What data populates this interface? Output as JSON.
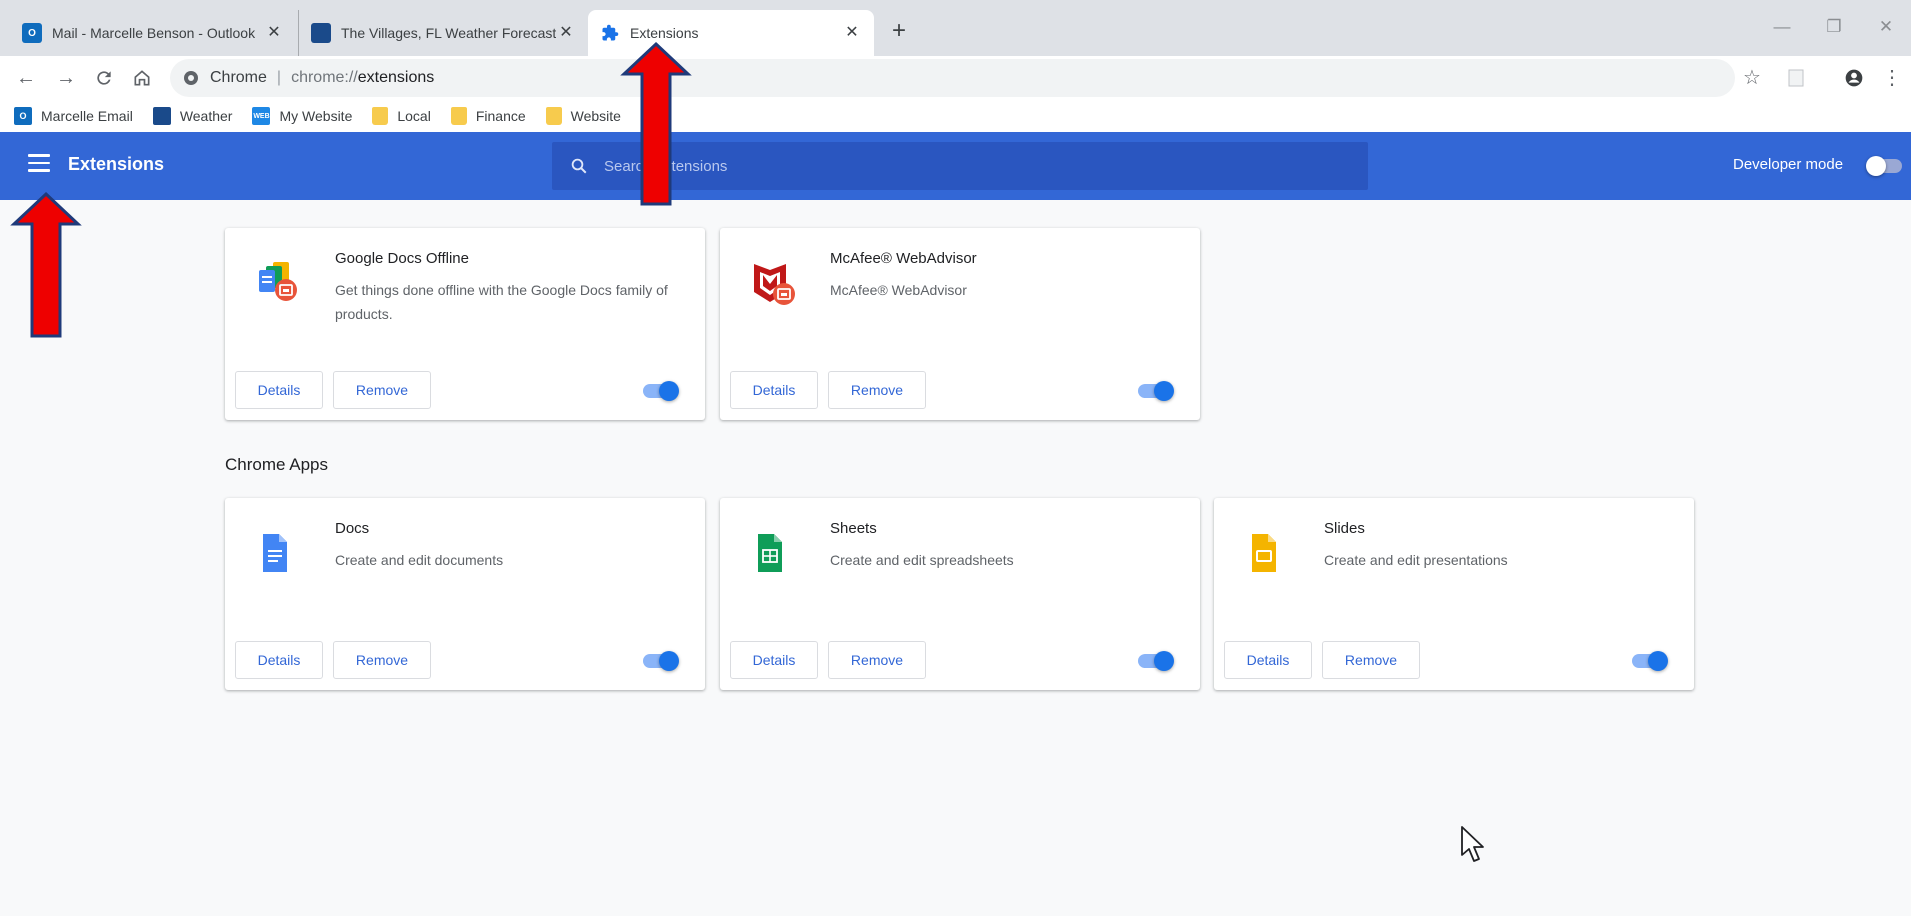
{
  "tabs": [
    {
      "title": "Mail - Marcelle Benson - Outlook",
      "icon": "outlook-icon",
      "color": "#0f6cbd"
    },
    {
      "title": "The Villages, FL Weather Forecast",
      "icon": "weather-icon",
      "color": "#1a4a8a"
    },
    {
      "title": "Extensions",
      "icon": "puzzle-icon",
      "color": "#1a73e8"
    }
  ],
  "tab_close_glyph": "✕",
  "new_tab_glyph": "+",
  "window_controls": {
    "minimize": "—",
    "restore": "❐",
    "close": "✕"
  },
  "omnibox": {
    "site": "Chrome",
    "separator": "|",
    "url_scheme": "chrome://",
    "url_path": "extensions"
  },
  "bookmarks": [
    {
      "label": "Marcelle Email",
      "icon": "outlook-icon",
      "color": "#0f6cbd",
      "badge": "O"
    },
    {
      "label": "Weather",
      "icon": "weather-icon",
      "color": "#1a4a8a",
      "badge": ""
    },
    {
      "label": "My Website",
      "icon": "website-icon",
      "color": "#1e88e5",
      "badge": "WEB"
    },
    {
      "label": "Local",
      "icon": "folder-icon",
      "color": "#f7cb4d",
      "badge": ""
    },
    {
      "label": "Finance",
      "icon": "folder-icon",
      "color": "#f7cb4d",
      "badge": ""
    },
    {
      "label": "Website",
      "icon": "folder-icon",
      "color": "#f7cb4d",
      "badge": ""
    }
  ],
  "header": {
    "title": "Extensions",
    "search_placeholder": "Search extensions",
    "developer_mode_label": "Developer mode",
    "developer_mode": false,
    "bg_color": "#3367d6"
  },
  "extensions": [
    {
      "name": "Google Docs Offline",
      "description": "Get things done offline with the Google Docs family of products.",
      "details_label": "Details",
      "remove_label": "Remove",
      "enabled": true,
      "icon": "google-docs-offline-icon"
    },
    {
      "name": "McAfee® WebAdvisor",
      "description": "McAfee® WebAdvisor",
      "details_label": "Details",
      "remove_label": "Remove",
      "enabled": true,
      "icon": "mcafee-icon"
    }
  ],
  "chrome_apps_title": "Chrome Apps",
  "apps": [
    {
      "name": "Docs",
      "description": "Create and edit documents",
      "details_label": "Details",
      "remove_label": "Remove",
      "enabled": true,
      "icon": "docs-icon",
      "color": "#4285f4"
    },
    {
      "name": "Sheets",
      "description": "Create and edit spreadsheets",
      "details_label": "Details",
      "remove_label": "Remove",
      "enabled": true,
      "icon": "sheets-icon",
      "color": "#0f9d58"
    },
    {
      "name": "Slides",
      "description": "Create and edit presentations",
      "details_label": "Details",
      "remove_label": "Remove",
      "enabled": true,
      "icon": "slides-icon",
      "color": "#f4b400"
    }
  ],
  "annotation_color": "#ee0000"
}
